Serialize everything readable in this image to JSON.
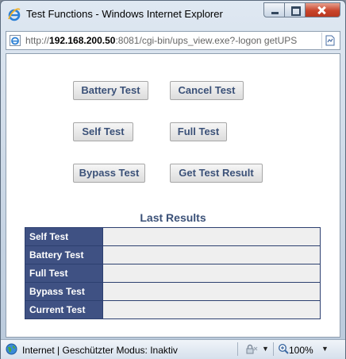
{
  "window": {
    "title": "Test Functions - Windows Internet Explorer"
  },
  "address": {
    "url_prefix": "http://",
    "url_host": "192.168.200.50",
    "url_rest": ":8081/cgi-bin/ups_view.exe?-logon getUPS"
  },
  "buttons": {
    "battery_test": "Battery Test",
    "cancel_test": "Cancel Test",
    "self_test": "Self Test",
    "full_test": "Full Test",
    "bypass_test": "Bypass Test",
    "get_test_result": "Get Test Result"
  },
  "results": {
    "title": "Last Results",
    "rows": [
      {
        "label": "Self Test",
        "value": ""
      },
      {
        "label": "Battery Test",
        "value": ""
      },
      {
        "label": "Full Test",
        "value": ""
      },
      {
        "label": "Bypass Test",
        "value": ""
      },
      {
        "label": "Current Test",
        "value": ""
      }
    ]
  },
  "status": {
    "zone_text": "Internet | Geschützter Modus: Inaktiv",
    "zoom": "100%"
  },
  "colors": {
    "accent": "#3b5178",
    "label_bg": "#3f5183",
    "cell_bg": "#efefef"
  }
}
